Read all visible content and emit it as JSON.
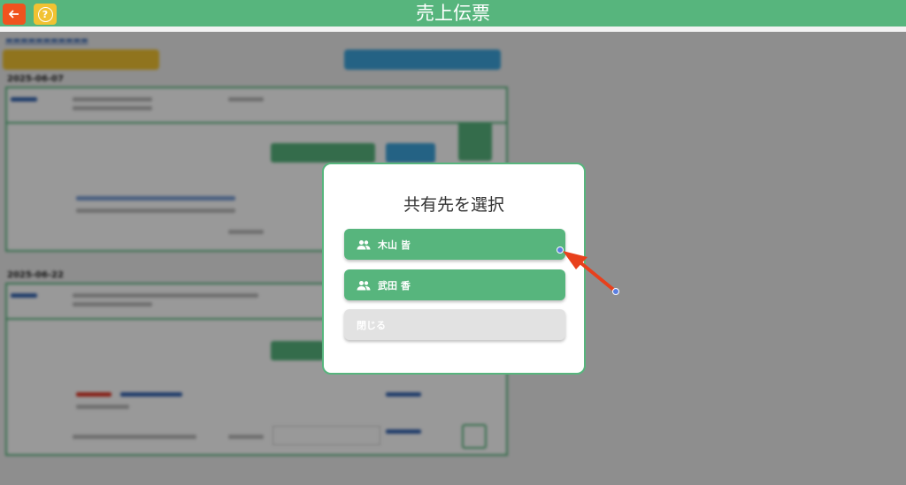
{
  "header": {
    "title": "売上伝票",
    "back_icon": "arrow-left-icon",
    "help_icon": "question-circle-icon",
    "colors": {
      "bar": "#57b57d",
      "back": "#f0531e",
      "help": "#f1c232"
    }
  },
  "modal": {
    "title": "共有先を選択",
    "options": [
      {
        "label": "木山 皆",
        "icon": "people-icon"
      },
      {
        "label": "武田 香",
        "icon": "people-icon"
      }
    ],
    "close_label": "閉じる"
  },
  "background": {
    "dates": [
      "2025-06-07",
      "2025-06-22"
    ]
  }
}
